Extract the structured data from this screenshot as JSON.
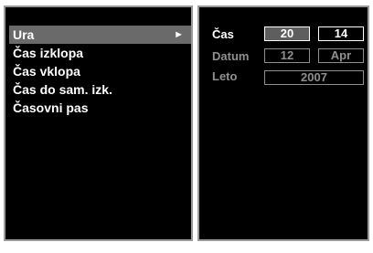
{
  "menu": {
    "items": [
      {
        "label": "Ura",
        "selected": true,
        "arrow": "►"
      },
      {
        "label": "Čas izklopa"
      },
      {
        "label": "Čas vklopa"
      },
      {
        "label": "Čas do sam. izk."
      },
      {
        "label": "Časovni pas"
      }
    ]
  },
  "settings": {
    "time": {
      "label": "Čas",
      "hour": "20",
      "minute": "14"
    },
    "date": {
      "label": "Datum",
      "day": "12",
      "month": "Apr"
    },
    "year": {
      "label": "Leto",
      "value": "2007"
    }
  },
  "colors": {
    "background": "#000000",
    "text": "#ffffff",
    "dim_text": "#8f8f8f",
    "highlight": "#6a6a6a",
    "panel_border": "#9a9a9a"
  },
  "icons": {
    "selected_arrow": "arrow-right-icon"
  }
}
